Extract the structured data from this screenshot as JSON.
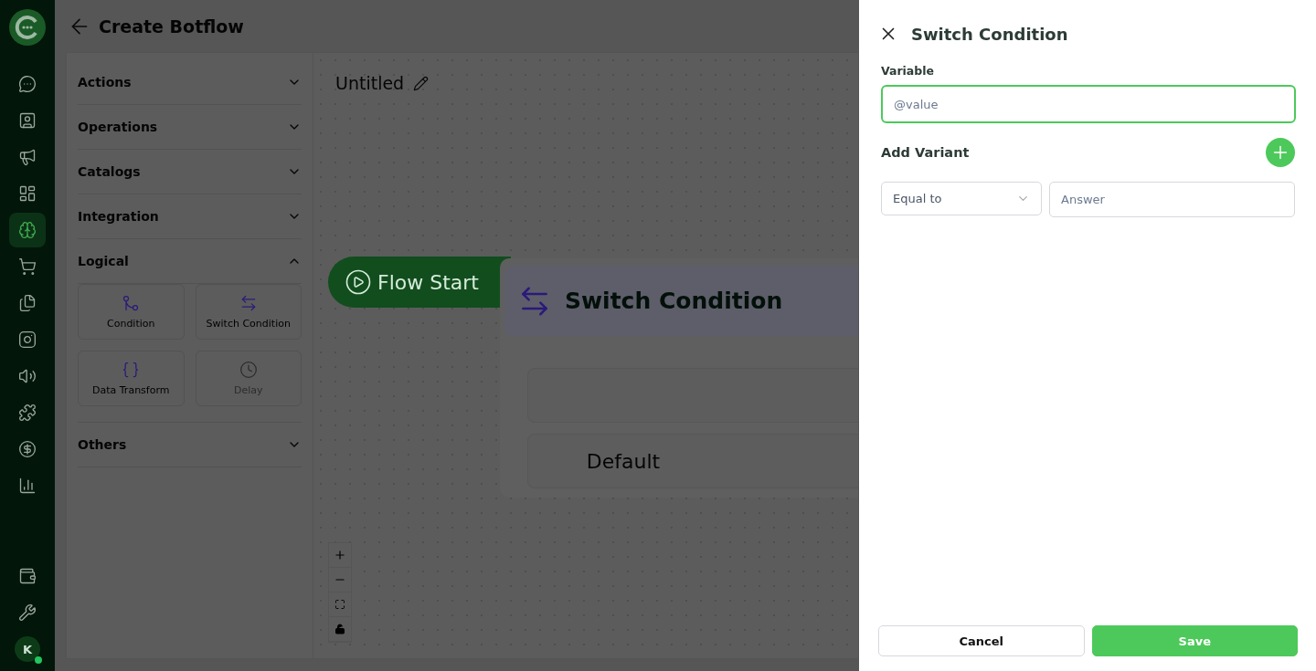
{
  "nav_rail": {
    "items": [
      {
        "selected": false
      },
      {
        "selected": false
      },
      {
        "selected": false
      },
      {
        "selected": false
      },
      {
        "selected": true
      },
      {
        "selected": false
      },
      {
        "selected": false
      },
      {
        "selected": false
      },
      {
        "selected": false
      },
      {
        "selected": false
      },
      {
        "selected": false
      },
      {
        "selected": false
      }
    ],
    "bottom_items": [
      {
        "selected": false
      },
      {
        "selected": false
      }
    ],
    "avatar": {
      "initial": "K",
      "online": true
    }
  },
  "header": {
    "title": "Create Botflow"
  },
  "palette": {
    "sections": [
      {
        "title": "Actions",
        "expanded": false
      },
      {
        "title": "Operations",
        "expanded": false
      },
      {
        "title": "Catalogs",
        "expanded": false
      },
      {
        "title": "Integration",
        "expanded": false
      },
      {
        "title": "Logical",
        "expanded": true,
        "blocks": [
          {
            "label": "Condition",
            "disabled": false
          },
          {
            "label": "Switch Condition",
            "disabled": false
          },
          {
            "label": "Data Transform",
            "disabled": false
          },
          {
            "label": "Delay",
            "disabled": true
          }
        ]
      },
      {
        "title": "Others",
        "expanded": false
      }
    ]
  },
  "canvas": {
    "title": "Untitled",
    "nodes": [
      {
        "kind": "start",
        "label": "Flow Start"
      },
      {
        "kind": "switch",
        "title": "Switch Condition",
        "branches": [
          {
            "kind": "variant"
          },
          {
            "kind": "default",
            "label": "Default"
          }
        ]
      }
    ]
  },
  "drawer": {
    "title": "Switch Condition",
    "variable": {
      "label": "Variable",
      "placeholder": "@value",
      "focused": true
    },
    "add_variant": {
      "label": "Add Variant"
    },
    "variants": [
      {
        "operator": "Equal to",
        "placeholder": "Answer"
      }
    ],
    "buttons": [
      {
        "label": "Cancel",
        "kind": "secondary"
      },
      {
        "label": "Save",
        "kind": "primary"
      }
    ]
  }
}
